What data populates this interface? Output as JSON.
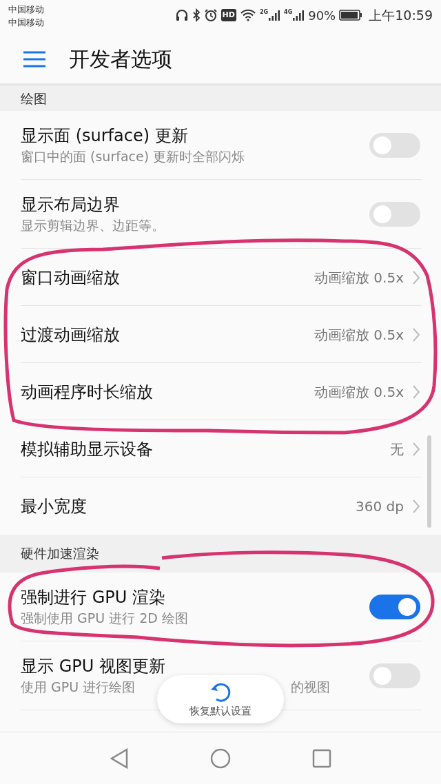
{
  "status_bar": {
    "carriers": [
      "中国移动",
      "中国移动"
    ],
    "network_labels": [
      "2G",
      "4G"
    ],
    "hd": "HD",
    "battery_text": "90%",
    "time": "上午10:59"
  },
  "header": {
    "title": "开发者选项"
  },
  "sections": [
    {
      "title": "绘图",
      "rows": [
        {
          "kind": "toggle",
          "title": "显示面 (surface) 更新",
          "subtitle": "窗口中的面 (surface) 更新时全部闪烁",
          "on": false
        },
        {
          "kind": "toggle",
          "title": "显示布局边界",
          "subtitle": "显示剪辑边界、边距等。",
          "on": false
        },
        {
          "kind": "value",
          "title": "窗口动画缩放",
          "value": "动画缩放 0.5x"
        },
        {
          "kind": "value",
          "title": "过渡动画缩放",
          "value": "动画缩放 0.5x"
        },
        {
          "kind": "value",
          "title": "动画程序时长缩放",
          "value": "动画缩放 0.5x"
        },
        {
          "kind": "value",
          "title": "模拟辅助显示设备",
          "value": "无"
        },
        {
          "kind": "value",
          "title": "最小宽度",
          "value": "360 dp"
        }
      ]
    },
    {
      "title": "硬件加速渲染",
      "rows": [
        {
          "kind": "toggle",
          "title": "强制进行 GPU 渲染",
          "subtitle": "强制使用 GPU 进行 2D 绘图",
          "on": true
        },
        {
          "kind": "toggle",
          "title": "显示 GPU 视图更新",
          "subtitle_parts": [
            "使用 GPU 进行绘图",
            "的视图"
          ],
          "on": false
        }
      ]
    }
  ],
  "toast": {
    "label": "恢复默认设置"
  }
}
